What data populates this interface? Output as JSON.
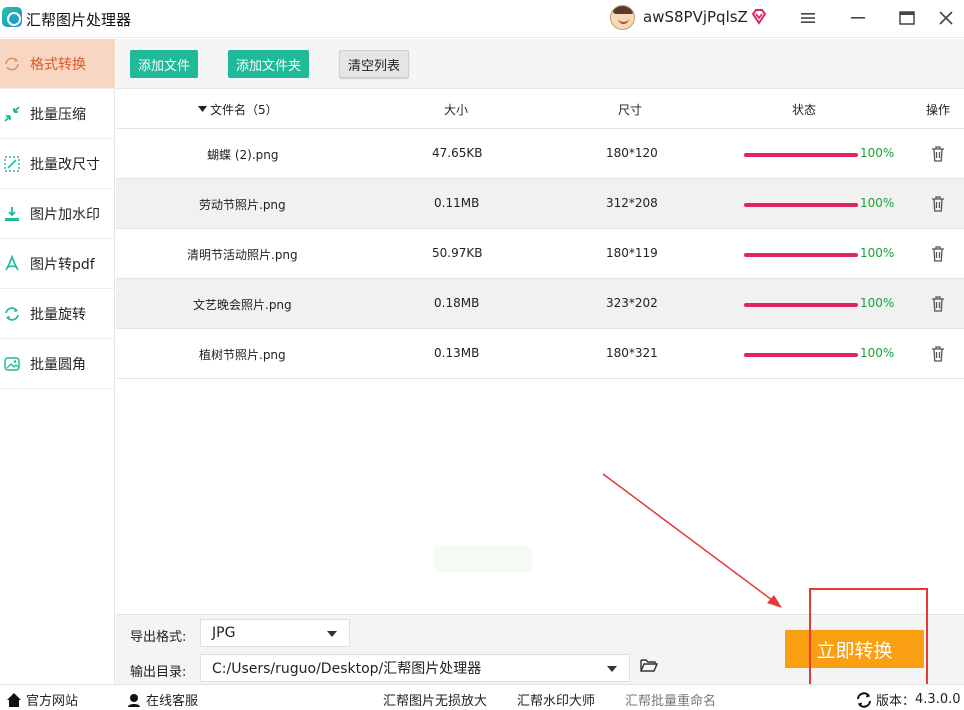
{
  "app": {
    "title": "汇帮图片处理器"
  },
  "user": {
    "name": "awS8PVjPqlsZ"
  },
  "colors": {
    "accent_orange": "#fa9e12",
    "active_bg": "#f7d7c1",
    "active_text": "#e25627",
    "green_btn": "#20b99a",
    "progress": "#e0245e",
    "percent": "#1aa33a",
    "annotation_red": "#e53935"
  },
  "sidebar": {
    "items": [
      {
        "label": "格式转换",
        "icon": "format-convert-icon",
        "active": true
      },
      {
        "label": "批量压缩",
        "icon": "compress-icon"
      },
      {
        "label": "批量改尺寸",
        "icon": "resize-icon"
      },
      {
        "label": "图片加水印",
        "icon": "watermark-icon"
      },
      {
        "label": "图片转pdf",
        "icon": "pdf-icon"
      },
      {
        "label": "批量旋转",
        "icon": "rotate-icon"
      },
      {
        "label": "批量圆角",
        "icon": "rounded-corner-icon"
      }
    ]
  },
  "toolbar": {
    "add_file": "添加文件",
    "add_folder": "添加文件夹",
    "clear_list": "清空列表"
  },
  "table": {
    "headers": {
      "name": "文件名（5）",
      "size": "大小",
      "dimension": "尺寸",
      "status": "状态",
      "action": "操作"
    },
    "rows": [
      {
        "name": "蝴蝶 (2).png",
        "size": "47.65KB",
        "dimension": "180*120",
        "progress": 1.0,
        "status": "100%"
      },
      {
        "name": "劳动节照片.png",
        "size": "0.11MB",
        "dimension": "312*208",
        "progress": 1.0,
        "status": "100%"
      },
      {
        "name": "清明节活动照片.png",
        "size": "50.97KB",
        "dimension": "180*119",
        "progress": 1.0,
        "status": "100%"
      },
      {
        "name": "文艺晚会照片.png",
        "size": "0.18MB",
        "dimension": "323*202",
        "progress": 1.0,
        "status": "100%"
      },
      {
        "name": "植树节照片.png",
        "size": "0.13MB",
        "dimension": "180*321",
        "progress": 1.0,
        "status": "100%"
      }
    ]
  },
  "settings": {
    "format_label": "导出格式:",
    "format_value": "JPG",
    "output_label": "输出目录:",
    "output_value": "C:/Users/ruguo/Desktop/汇帮图片处理器",
    "convert_button": "立即转换"
  },
  "footer": {
    "website": "官方网站",
    "support": "在线客服",
    "links": [
      "汇帮图片无损放大",
      "汇帮水印大师",
      "汇帮批量重命名"
    ],
    "version_label": "版本：",
    "version_value": "4.3.0.0"
  }
}
